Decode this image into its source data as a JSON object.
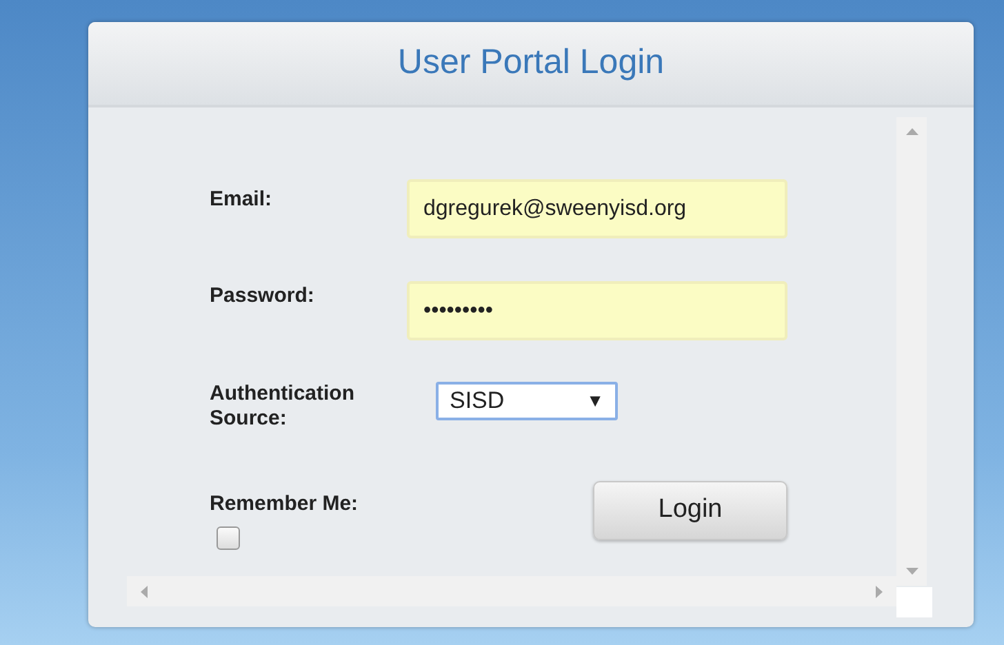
{
  "panel": {
    "title": "User Portal Login"
  },
  "form": {
    "email": {
      "label": "Email:",
      "value": "dgregurek@sweenyisd.org"
    },
    "password": {
      "label": "Password:",
      "value": "•••••••••"
    },
    "auth_source": {
      "label": "Authentication Source:",
      "value": "SISD",
      "arrow": "▼"
    },
    "remember": {
      "label": "Remember Me:",
      "checked": false
    },
    "login_button": "Login"
  }
}
